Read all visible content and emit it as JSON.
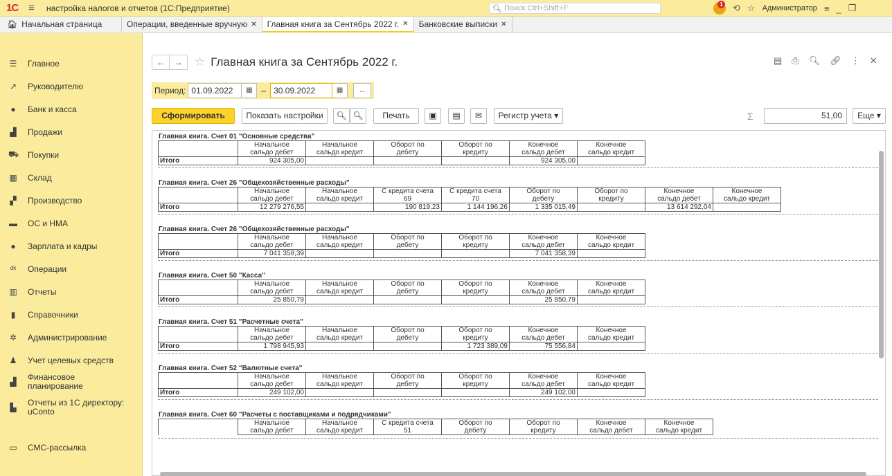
{
  "window": {
    "title": "настройка налогов и отчетов (1С:Предприятие)",
    "logo": "1С",
    "search_placeholder": "Поиск Ctrl+Shift+F",
    "user": "Администратор",
    "notif_count": "1"
  },
  "tabs": [
    {
      "label": "Начальная страница"
    },
    {
      "label": "Операции, введенные вручную"
    },
    {
      "label": "Главная книга за Сентябрь 2022 г."
    },
    {
      "label": "Банковские выписки"
    }
  ],
  "sidebar": [
    {
      "label": "Главное",
      "icon": "menu-icon"
    },
    {
      "label": "Руководителю",
      "icon": "chart-line-icon"
    },
    {
      "label": "Банк и касса",
      "icon": "coin-icon"
    },
    {
      "label": "Продажи",
      "icon": "bag-icon"
    },
    {
      "label": "Покупки",
      "icon": "cart-icon"
    },
    {
      "label": "Склад",
      "icon": "warehouse-icon"
    },
    {
      "label": "Производство",
      "icon": "factory-icon"
    },
    {
      "label": "ОС и НМА",
      "icon": "truck-icon"
    },
    {
      "label": "Зарплата и кадры",
      "icon": "person-icon"
    },
    {
      "label": "Операции",
      "icon": "dt-kt-icon"
    },
    {
      "label": "Отчеты",
      "icon": "bar-chart-icon"
    },
    {
      "label": "Справочники",
      "icon": "book-icon"
    },
    {
      "label": "Администрирование",
      "icon": "gear-icon"
    },
    {
      "label": "Учет целевых средств",
      "icon": "people-icon"
    },
    {
      "label": "Финансовое\nпланирование",
      "icon": "finance-icon"
    },
    {
      "label": "Отчеты из 1С директору:\nuConto",
      "icon": "report-icon"
    },
    {
      "label": "СМС-рассылка",
      "icon": "sms-icon"
    }
  ],
  "header": {
    "title": "Главная книга за Сентябрь 2022 г."
  },
  "period": {
    "label": "Период:",
    "from": "01.09.2022",
    "dash": "–",
    "to": "30.09.2022",
    "more": "..."
  },
  "toolbar": {
    "generate": "Сформировать",
    "settings": "Показать настройки",
    "print": "Печать",
    "register": "Регистр учета",
    "more": "Еще",
    "sum_value": "51,00",
    "sum_symbol": "Σ"
  },
  "report": {
    "total_label": "Итого",
    "sections": [
      {
        "title": "Главная книга. Счет 01 \"Основные средства\"",
        "cols": [
          [
            "Начальное",
            "сальдо дебет"
          ],
          [
            "Начальное",
            "сальдо кредит"
          ],
          [
            "Оборот по",
            "дебету"
          ],
          [
            "Оборот по",
            "кредиту"
          ],
          [
            "Конечное",
            "сальдо дебет"
          ],
          [
            "Конечное",
            "сальдо кредит"
          ]
        ],
        "values": [
          "924 305,00",
          "",
          "",
          "",
          "924 305,00",
          ""
        ]
      },
      {
        "title": "Главная книга. Счет 26 \"Общехозяйственные расходы\"",
        "cols": [
          [
            "Начальное",
            "сальдо дебет"
          ],
          [
            "Начальное",
            "сальдо кредит"
          ],
          [
            "С кредита счета",
            "69"
          ],
          [
            "С кредита счета",
            "70"
          ],
          [
            "Оборот по",
            "дебету"
          ],
          [
            "Оборот по",
            "кредиту"
          ],
          [
            "Конечное",
            "сальдо дебет"
          ],
          [
            "Конечное",
            "сальдо кредит"
          ]
        ],
        "values": [
          "12 279 276,55",
          "",
          "190 819,23",
          "1 144 196,26",
          "1 335 015,49",
          "",
          "13 614 292,04",
          ""
        ]
      },
      {
        "title": "Главная книга. Счет 26 \"Общехозяйственные расходы\"",
        "cols": [
          [
            "Начальное",
            "сальдо дебет"
          ],
          [
            "Начальное",
            "сальдо кредит"
          ],
          [
            "Оборот по",
            "дебету"
          ],
          [
            "Оборот по",
            "кредиту"
          ],
          [
            "Конечное",
            "сальдо дебет"
          ],
          [
            "Конечное",
            "сальдо кредит"
          ]
        ],
        "values": [
          "7 041 358,39",
          "",
          "",
          "",
          "7 041 358,39",
          ""
        ]
      },
      {
        "title": "Главная книга. Счет 50 \"Касса\"",
        "cols": [
          [
            "Начальное",
            "сальдо дебет"
          ],
          [
            "Начальное",
            "сальдо кредит"
          ],
          [
            "Оборот по",
            "дебету"
          ],
          [
            "Оборот по",
            "кредиту"
          ],
          [
            "Конечное",
            "сальдо дебет"
          ],
          [
            "Конечное",
            "сальдо кредит"
          ]
        ],
        "values": [
          "25 850,79",
          "",
          "",
          "",
          "25 850,79",
          ""
        ]
      },
      {
        "title": "Главная книга. Счет 51 \"Расчетные счета\"",
        "cols": [
          [
            "Начальное",
            "сальдо дебет"
          ],
          [
            "Начальное",
            "сальдо кредит"
          ],
          [
            "Оборот по",
            "дебету"
          ],
          [
            "Оборот по",
            "кредиту"
          ],
          [
            "Конечное",
            "сальдо дебет"
          ],
          [
            "Конечное",
            "сальдо кредит"
          ]
        ],
        "values": [
          "1 798 945,93",
          "",
          "",
          "1 723 389,09",
          "75 556,84",
          ""
        ]
      },
      {
        "title": "Главная книга. Счет 52 \"Валютные счета\"",
        "cols": [
          [
            "Начальное",
            "сальдо дебет"
          ],
          [
            "Начальное",
            "сальдо кредит"
          ],
          [
            "Оборот по",
            "дебету"
          ],
          [
            "Оборот по",
            "кредиту"
          ],
          [
            "Конечное",
            "сальдо дебет"
          ],
          [
            "Конечное",
            "сальдо кредит"
          ]
        ],
        "values": [
          "249 102,00",
          "",
          "",
          "",
          "249 102,00",
          ""
        ]
      },
      {
        "title": "Главная книга. Счет 60 \"Расчеты с поставщиками и подрядчиками\"",
        "cols": [
          [
            "Начальное",
            "сальдо дебет"
          ],
          [
            "Начальное",
            "сальдо кредит"
          ],
          [
            "С кредита счета",
            "51"
          ],
          [
            "Оборот по",
            "дебету"
          ],
          [
            "Оборот по",
            "кредиту"
          ],
          [
            "Конечное",
            "сальдо дебет"
          ],
          [
            "Конечное",
            "сальдо кредит"
          ]
        ],
        "values": null
      }
    ]
  }
}
